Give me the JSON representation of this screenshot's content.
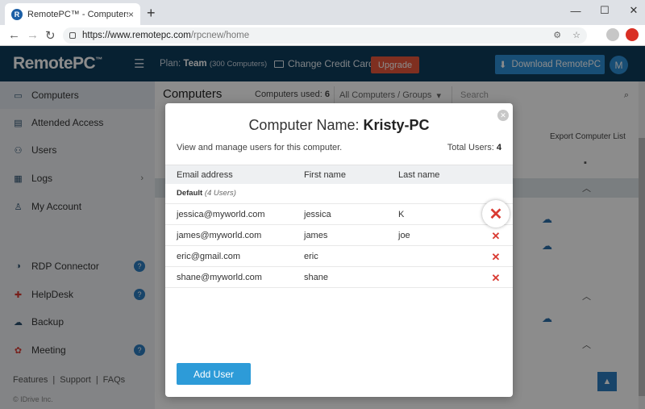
{
  "browser": {
    "tab_title": "RemotePC™ - Computers",
    "url_host": "https://www.remotepc.com",
    "url_path": "/rpcnew/home",
    "new_tab": "+",
    "close_tab": "×"
  },
  "header": {
    "logo": "RemotePC",
    "logo_tm": "™",
    "plan_label": "Plan:",
    "plan_name": "Team",
    "plan_detail": "(300 Computers)",
    "change_card": "Change Credit Card",
    "upgrade": "Upgrade",
    "download": "Download RemotePC",
    "avatar": "M"
  },
  "sidebar": {
    "items": [
      {
        "label": "Computers",
        "icon": "monitor-icon"
      },
      {
        "label": "Attended Access",
        "icon": "attended-icon"
      },
      {
        "label": "Users",
        "icon": "users-icon"
      },
      {
        "label": "Logs",
        "icon": "logs-icon"
      },
      {
        "label": "My Account",
        "icon": "account-icon"
      },
      {
        "label": "RDP Connector",
        "icon": "rdp-icon"
      },
      {
        "label": "HelpDesk",
        "icon": "helpdesk-icon"
      },
      {
        "label": "Backup",
        "icon": "backup-icon"
      },
      {
        "label": "Meeting",
        "icon": "meeting-icon"
      }
    ],
    "footer": [
      "Features",
      "Support",
      "FAQs"
    ],
    "copyright": "© IDrive Inc."
  },
  "main": {
    "title": "Computers",
    "used_label": "Computers used:",
    "used_count": "6",
    "filter": "All Computers / Groups",
    "search_placeholder": "Search",
    "export": "Export Computer List"
  },
  "modal": {
    "title_prefix": "Computer Name:",
    "computer_name": "Kristy-PC",
    "description": "View and manage users for this computer.",
    "total_label": "Total Users:",
    "total_count": "4",
    "columns": [
      "Email address",
      "First name",
      "Last name"
    ],
    "group_name": "Default",
    "group_count": "(4 Users)",
    "rows": [
      {
        "email": "jessica@myworld.com",
        "first": "jessica",
        "last": "K"
      },
      {
        "email": "james@myworld.com",
        "first": "james",
        "last": "joe"
      },
      {
        "email": "eric@gmail.com",
        "first": "eric",
        "last": ""
      },
      {
        "email": "shane@myworld.com",
        "first": "shane",
        "last": ""
      }
    ],
    "delete_glyph": "✕",
    "add_user": "Add User"
  },
  "colors": {
    "header_bg": "#0e3c5c",
    "accent": "#2d9bd8",
    "upgrade": "#e7573b",
    "delete": "#d93a32"
  }
}
